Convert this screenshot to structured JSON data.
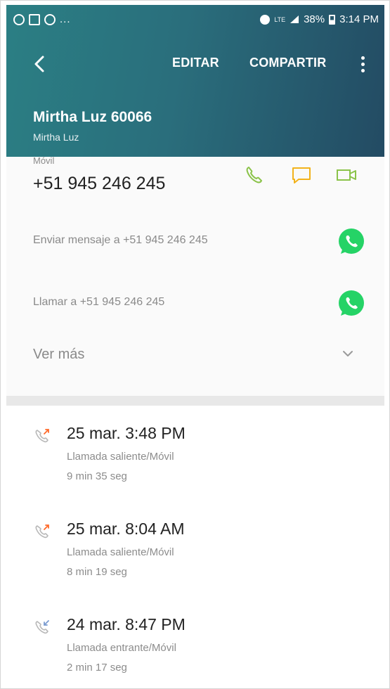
{
  "status_bar": {
    "left_dots": "...",
    "lte_label": "LTE",
    "battery": "38%",
    "time": "3:14 PM"
  },
  "toolbar": {
    "edit_label": "EDITAR",
    "share_label": "COMPARTIR"
  },
  "contact": {
    "name": "Mirtha Luz 60066",
    "subname": "Mirtha Luz"
  },
  "phone": {
    "type": "Móvil",
    "number": "+51 945 246 245"
  },
  "whatsapp": {
    "message": "Enviar mensaje a +51 945 246 245",
    "call": "Llamar a +51 945 246 245"
  },
  "more_label": "Ver más",
  "calls": [
    {
      "date": "25 mar. 3:48 PM",
      "type": "Llamada saliente/Móvil",
      "duration": "9 min 35 seg",
      "direction": "outgoing"
    },
    {
      "date": "25 mar. 8:04 AM",
      "type": "Llamada saliente/Móvil",
      "duration": "8 min 19 seg",
      "direction": "outgoing"
    },
    {
      "date": "24 mar. 8:47 PM",
      "type": "Llamada entrante/Móvil",
      "duration": "2 min 17 seg",
      "direction": "incoming"
    }
  ],
  "colors": {
    "header_start": "#2b7f84",
    "header_end": "#234b63",
    "call_green": "#8bc34a",
    "message_orange": "#f2b21b",
    "whatsapp_green": "#25d366",
    "outgoing_arrow": "#ff6a2a"
  }
}
